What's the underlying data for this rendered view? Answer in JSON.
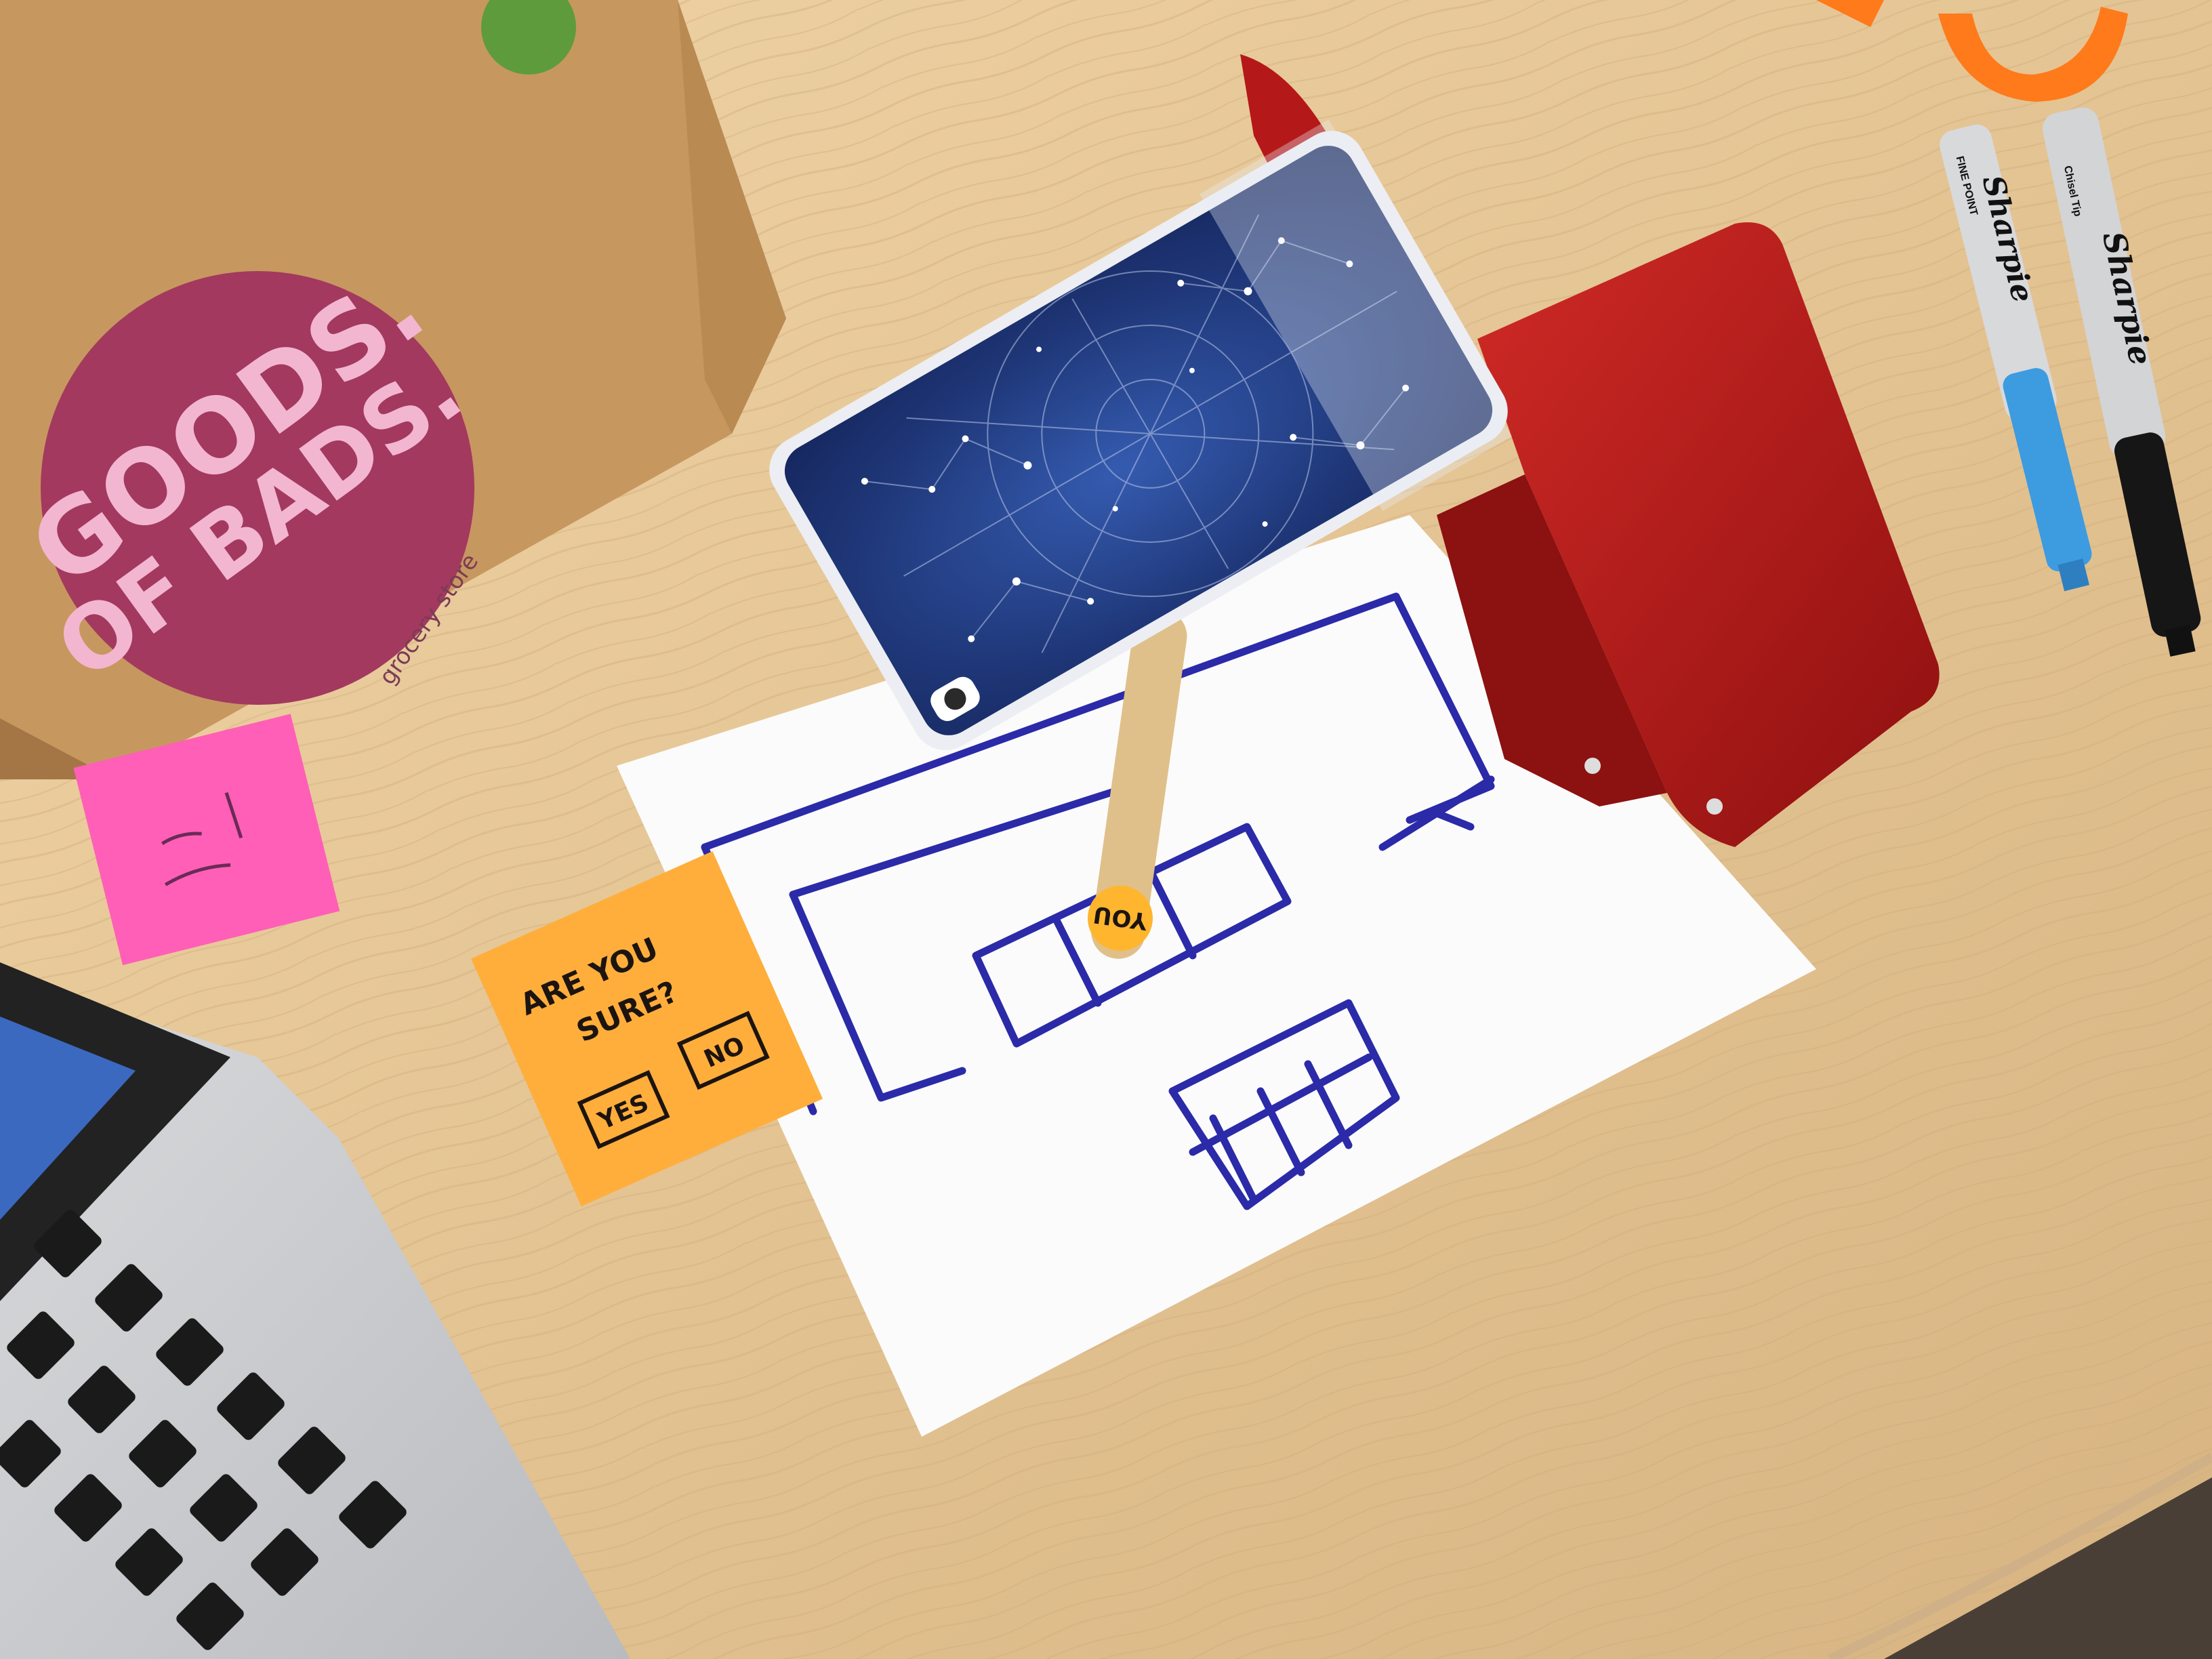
{
  "colors": {
    "desk": "#e3c595",
    "paper": "#fbfbfb",
    "ink": "#2b2a9e",
    "phone_case": "#1d3273",
    "red_holder": "#b01818",
    "orange_note": "#ffae3b",
    "pink_note": "#ff63b8",
    "bag": "#c99a66",
    "bag_circle": "#a03a63"
  },
  "grocery_bag": {
    "circle_line1": "GOODS.",
    "circle_line2": "OF BADS.",
    "rim_text": "grocery store"
  },
  "orange_sticky_note": {
    "question_line1": "ARE YOU",
    "question_line2": "SURE?",
    "yes_label": "YES",
    "no_label": "NO"
  },
  "popsicle_stick": {
    "label": "YOU"
  },
  "markers": {
    "marker1_brand": "Sharpie",
    "marker1_tip": "FINE POINT",
    "marker2_brand": "Sharpie",
    "marker2_tip": "Chisel Tip"
  }
}
